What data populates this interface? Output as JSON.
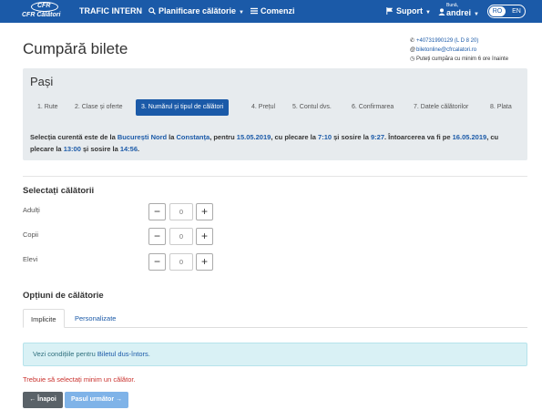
{
  "navbar": {
    "logo_mark": "CFR",
    "logo_name": "CFR Călători",
    "trafic": "TRAFIC INTERN",
    "planificare": "Planificare călătorie",
    "comenzi": "Comenzi",
    "suport": "Suport",
    "hello": "Bună,",
    "user": "andrei",
    "lang_ro": "RO",
    "lang_en": "EN"
  },
  "header": {
    "title": "Cumpără bilete",
    "phone": "+40731990129 (L D 8 20)",
    "email": "biletonline@cfrcalatori.ro",
    "note": "Puteți cumpăra cu minim 6 ore înainte"
  },
  "steps": {
    "title": "Pași",
    "items": [
      "1. Rute",
      "2. Clase și oferte",
      "3. Numărul și tipul de călători",
      "4. Prețul",
      "5. Contul dvs.",
      "6. Confirmarea",
      "7. Datele călătorilor",
      "8. Plata"
    ],
    "active_index": 2
  },
  "selection": {
    "t1": "Selecția curentă este de la ",
    "from": "București Nord",
    "t2": " la ",
    "to": "Constanța",
    "t3": ", pentru ",
    "date_out": "15.05.2019",
    "t4": ", cu plecare la ",
    "dep_out": "7:10",
    "t5": " și sosire la ",
    "arr_out": "9:27",
    "t6": ". Întoarcerea va fi pe ",
    "date_ret": "16.05.2019",
    "t7": ", cu plecare la ",
    "dep_ret": "13:00",
    "t8": " și sosire la ",
    "arr_ret": "14:56",
    "t9": "."
  },
  "travelers": {
    "title": "Selectați călătorii",
    "rows": [
      {
        "label": "Adulți",
        "value": "0"
      },
      {
        "label": "Copii",
        "value": "0"
      },
      {
        "label": "Elevi",
        "value": "0"
      }
    ]
  },
  "options": {
    "title": "Opțiuni de călătorie",
    "tab_implicite": "Implicite",
    "tab_personalizate": "Personalizate"
  },
  "info": {
    "prefix": "Vezi condițiile pentru ",
    "link": "Biletul dus-întors",
    "suffix": "."
  },
  "error": "Trebuie să selectați minim un călător.",
  "buttons": {
    "back": "Înapoi",
    "next": "Pasul următor"
  },
  "colors": {
    "brand": "#1b5aa8",
    "panel": "#e7ebee",
    "error": "#c9302c",
    "info_bg": "#d9f1f5"
  }
}
